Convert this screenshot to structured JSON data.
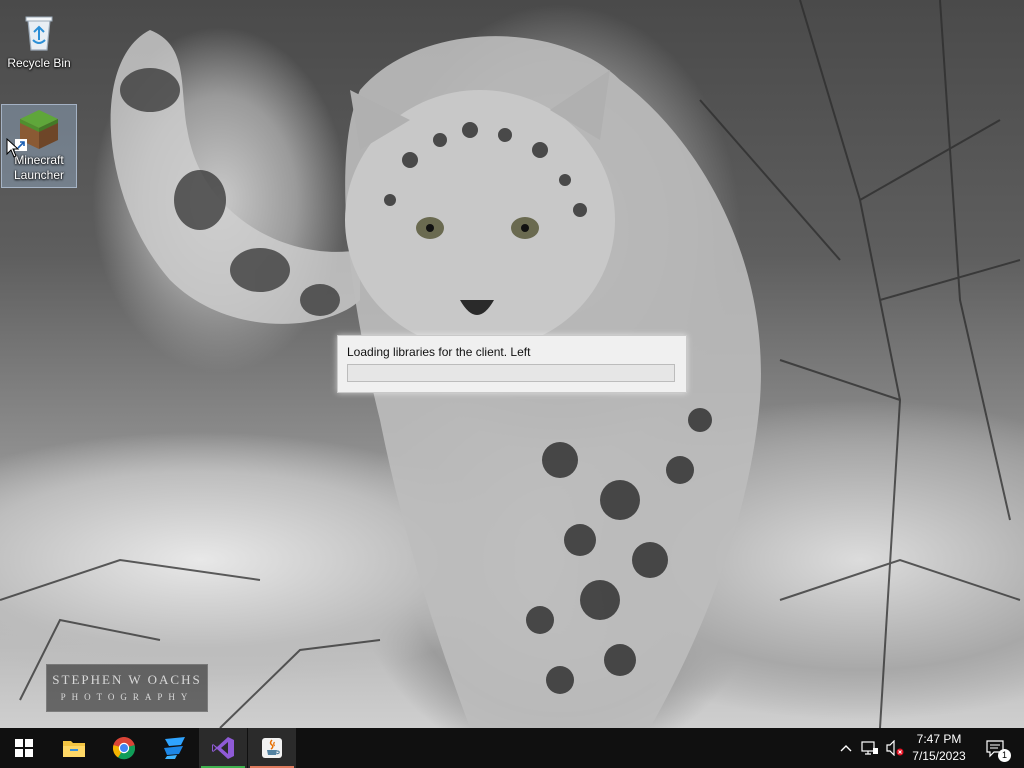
{
  "desktop": {
    "icons": [
      {
        "label": "Recycle Bin",
        "icon": "recycle-bin-icon"
      },
      {
        "label": "Minecraft\nLauncher",
        "label_line1": "Minecraft",
        "label_line2": "Launcher",
        "icon": "minecraft-grass-block-icon"
      }
    ],
    "watermark": {
      "line1": "STEPHEN W OACHS",
      "line2": "PHOTOGRAPHY"
    }
  },
  "loading_dialog": {
    "message": "Loading libraries for the client. Left",
    "progress": 0
  },
  "taskbar": {
    "items": [
      {
        "name": "start",
        "icon": "windows-logo-icon"
      },
      {
        "name": "file-explorer",
        "icon": "folder-icon"
      },
      {
        "name": "chrome",
        "icon": "chrome-icon"
      },
      {
        "name": "app-blue",
        "icon": "blue-app-icon"
      },
      {
        "name": "visual-studio",
        "icon": "visual-studio-icon",
        "active": true
      },
      {
        "name": "java",
        "icon": "java-icon",
        "active": true
      }
    ],
    "tray": {
      "icons": [
        "chevron-up-icon",
        "network-icon",
        "volume-muted-icon"
      ],
      "time": "7:47 PM",
      "date": "7/15/2023",
      "notification_count": "1"
    }
  },
  "colors": {
    "taskbar": "#101010",
    "progress_fill": "#06b025",
    "dialog_bg": "#f0f0f0"
  }
}
